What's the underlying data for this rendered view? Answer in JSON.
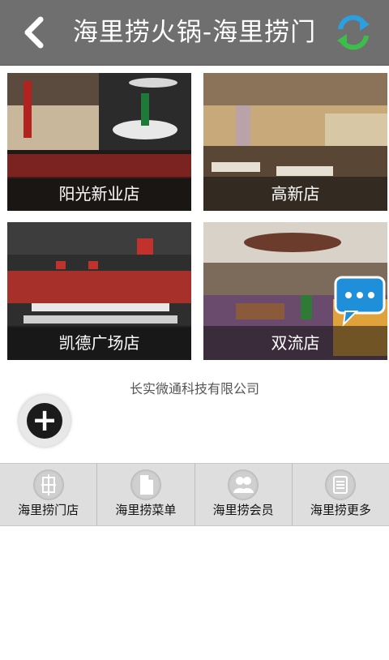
{
  "header": {
    "title": "海里捞火锅-海里捞门",
    "back_icon": "back-icon",
    "refresh_icon": "refresh-icon"
  },
  "stores": [
    {
      "name": "阳光新业店"
    },
    {
      "name": "高新店"
    },
    {
      "name": "凯德广场店"
    },
    {
      "name": "双流店"
    }
  ],
  "chat_icon": "chat-bubble-icon",
  "company": "长实微通科技有限公司",
  "fab_icon": "plus-icon",
  "tabbar": [
    {
      "label": "海里捞门店",
      "icon": "store-icon"
    },
    {
      "label": "海里捞菜单",
      "icon": "menu-doc-icon"
    },
    {
      "label": "海里捞会员",
      "icon": "members-icon"
    },
    {
      "label": "海里捞更多",
      "icon": "more-icon"
    }
  ],
  "colors": {
    "header_bg": "#6f6f6f",
    "accent_blue": "#2aa0e0",
    "accent_green": "#3bbf4a",
    "tabbar_bg": "#dedede"
  }
}
